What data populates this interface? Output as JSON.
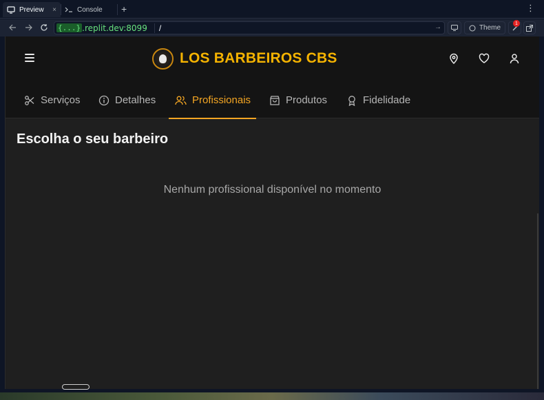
{
  "ide": {
    "tabs": [
      {
        "label": "Preview",
        "close": "×"
      },
      {
        "label": "Console"
      }
    ],
    "new_tab": "+",
    "menu": "⋮",
    "url_tag": "{...}",
    "url_host": ".replit.dev:8099",
    "url_path": "/",
    "theme_label": "Theme",
    "notification_count": "1"
  },
  "app": {
    "brand": "LOS BARBEIROS CBS",
    "nav_tabs": [
      {
        "label": "Serviços",
        "icon": "scissors-icon"
      },
      {
        "label": "Detalhes",
        "icon": "info-icon"
      },
      {
        "label": "Profissionais",
        "icon": "users-icon",
        "active": true
      },
      {
        "label": "Produtos",
        "icon": "shopping-bag-icon"
      },
      {
        "label": "Fidelidade",
        "icon": "award-icon"
      }
    ],
    "section_title": "Escolha o seu barbeiro",
    "empty_message": "Nenhum profissional disponível no momento",
    "accent_color": "#f5a623",
    "brand_color": "#f5b301"
  }
}
